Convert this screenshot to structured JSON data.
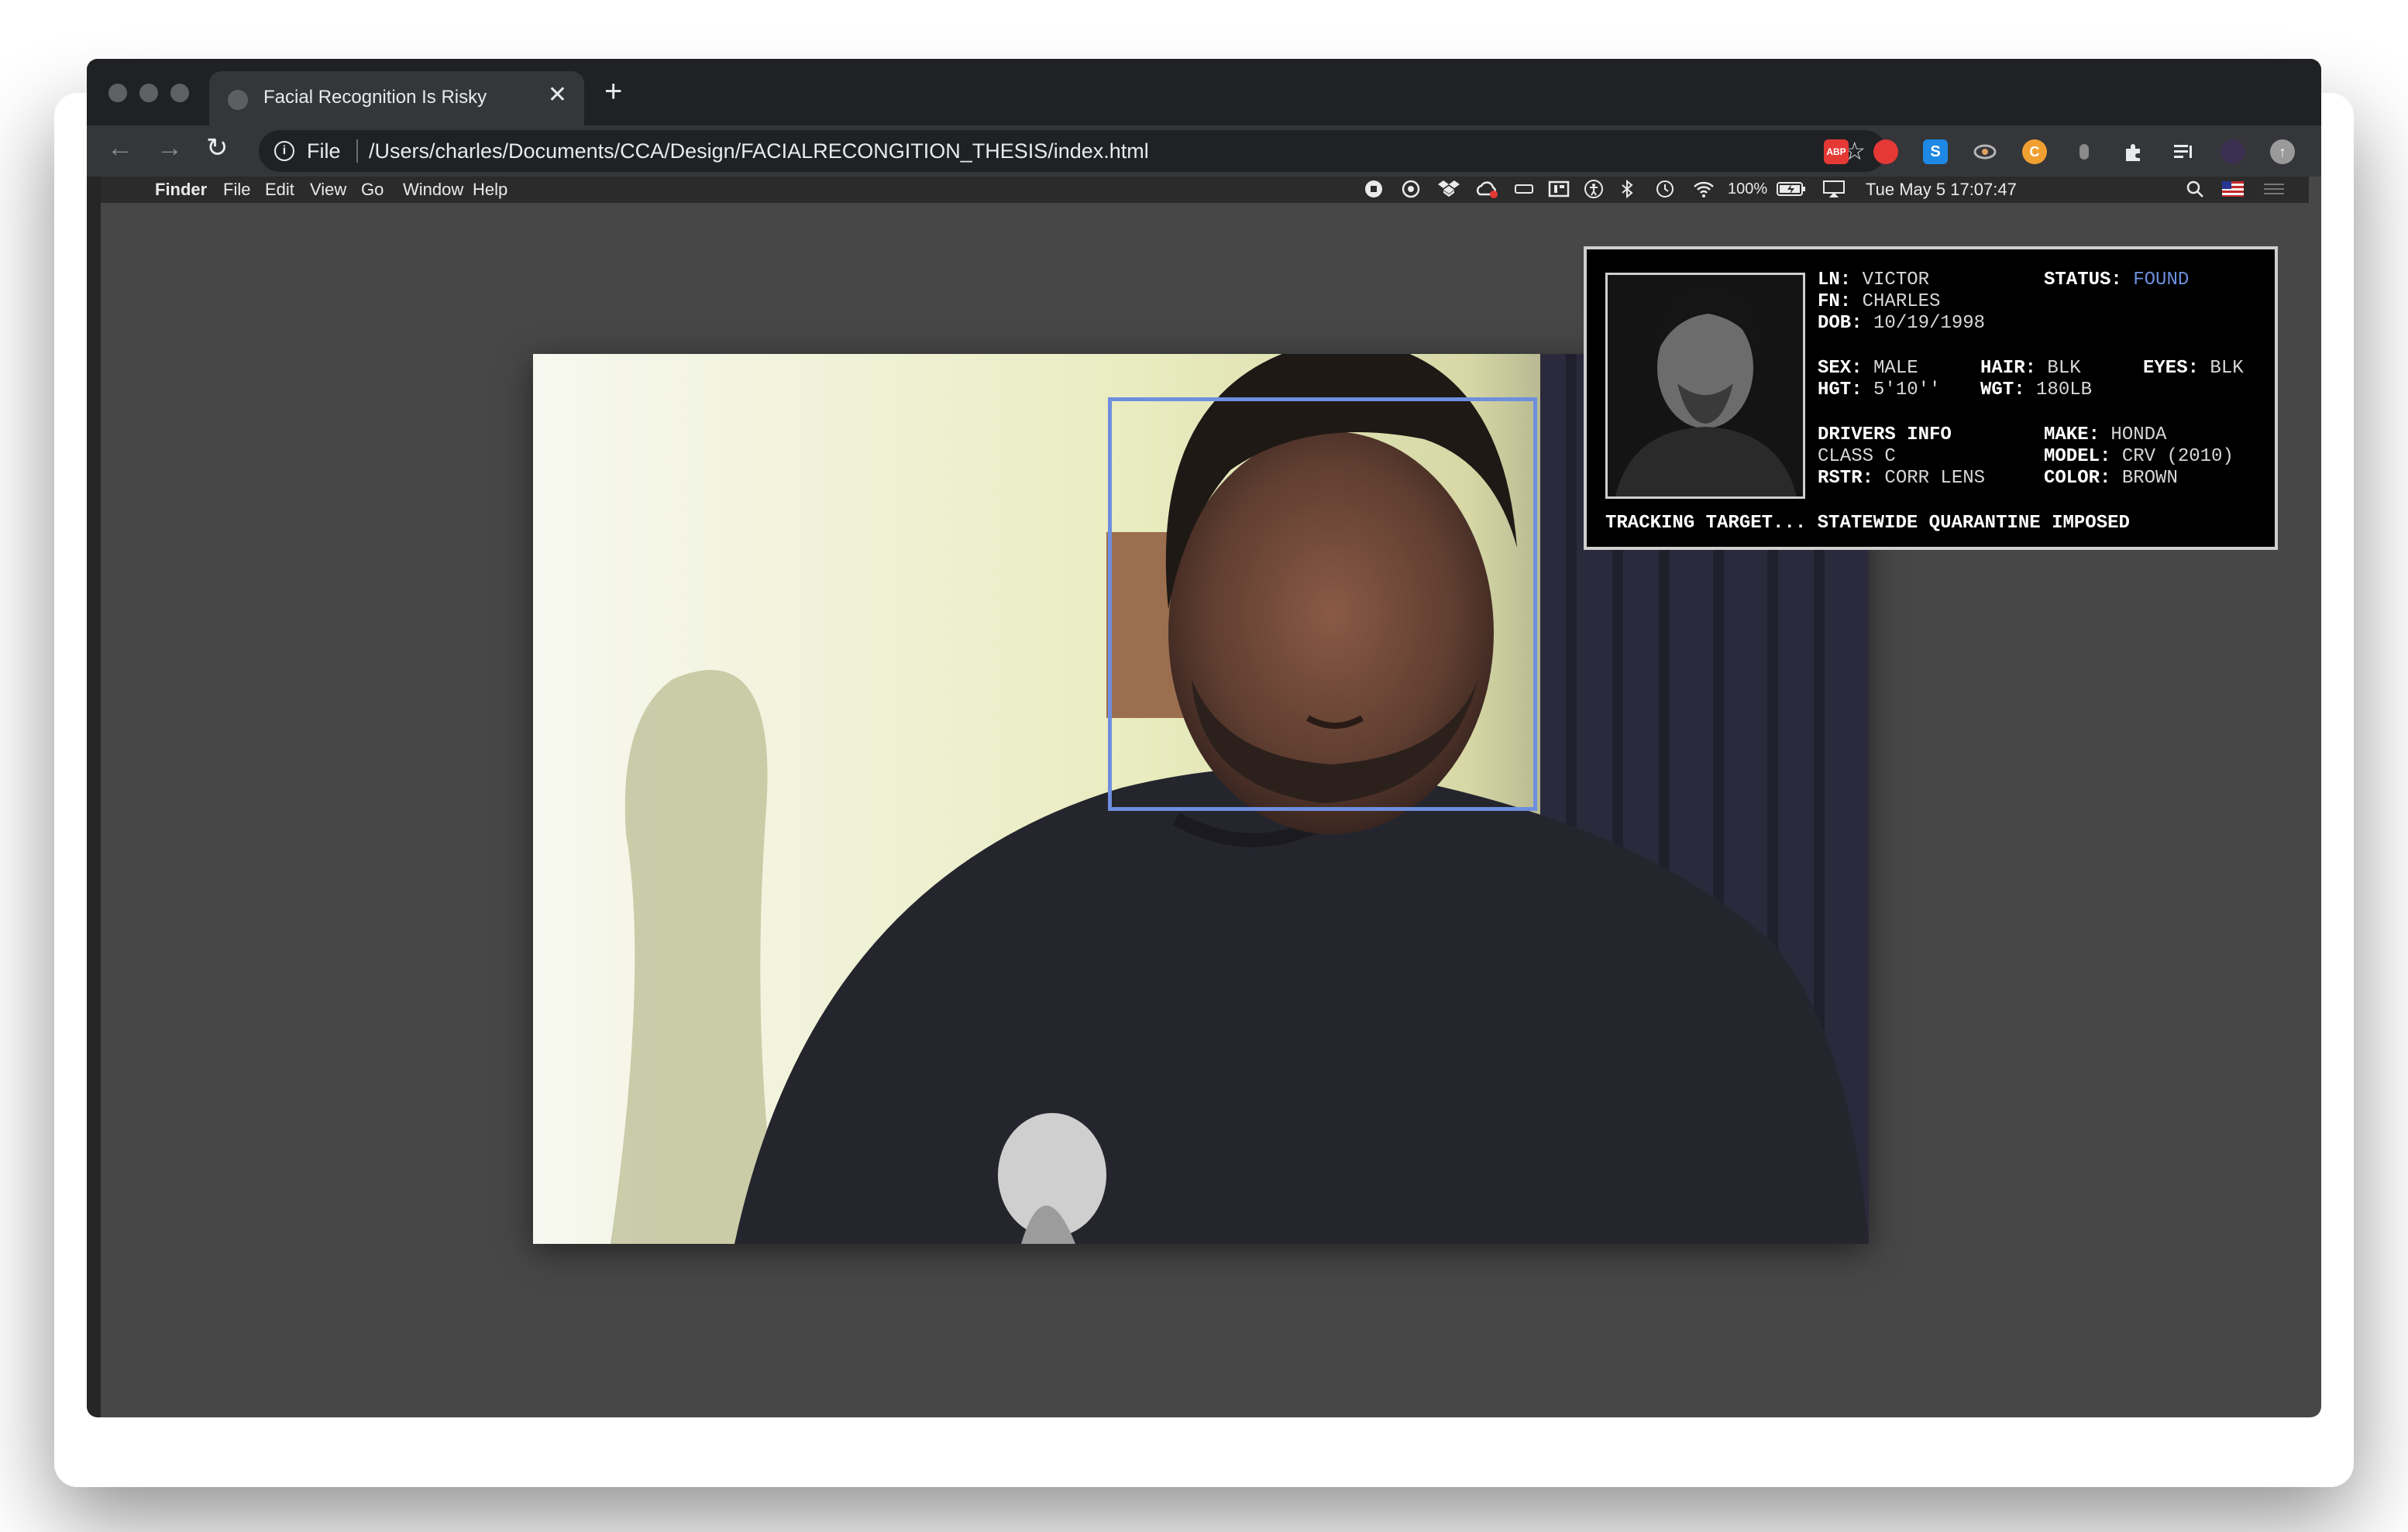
{
  "browser": {
    "tab_title": "Facial Recognition Is Risky",
    "tab_close": "✕",
    "new_tab": "+",
    "nav": {
      "back": "←",
      "forward": "→",
      "reload": "↻",
      "info": "i"
    },
    "address_scheme": "File",
    "address_url": "/Users/charles/Documents/CCA/Design/FACIALRECONGITION_THESIS/index.html",
    "bookmark_star": "☆",
    "extensions": [
      {
        "name": "adblock-plus-icon",
        "label": "ABP",
        "color": "#e53935"
      },
      {
        "name": "red-extension-icon",
        "label": "",
        "color": "#e53935"
      },
      {
        "name": "s-extension-icon",
        "label": "S",
        "color": "#1e88e5"
      },
      {
        "name": "eye-extension-icon",
        "label": "",
        "color": "#9e9e9e"
      },
      {
        "name": "c-extension-icon",
        "label": "C",
        "color": "#f0a030"
      },
      {
        "name": "mouse-extension-icon",
        "label": "",
        "color": "#9e9e9e"
      }
    ]
  },
  "menubar": {
    "apple": "",
    "app": "Finder",
    "items": [
      "File",
      "Edit",
      "View",
      "Go",
      "Window",
      "Help"
    ],
    "battery": "100%",
    "datetime": "Tue May 5  17:07:47"
  },
  "card": {
    "ln_label": "LN:",
    "ln": "VICTOR",
    "status_label": "STATUS:",
    "status": "FOUND",
    "fn_label": "FN:",
    "fn": "CHARLES",
    "dob_label": "DOB:",
    "dob": "10/19/1998",
    "sex_label": "SEX:",
    "sex": "MALE",
    "hair_label": "HAIR:",
    "hair": "BLK",
    "eyes_label": "EYES:",
    "eyes": "BLK",
    "hgt_label": "HGT:",
    "hgt": "5'10''",
    "wgt_label": "WGT:",
    "wgt": "180LB",
    "drivers_label": "DRIVERS INFO",
    "make_label": "MAKE:",
    "make": "HONDA",
    "class": "CLASS C",
    "model_label": "MODEL:",
    "model": "CRV (2010)",
    "rstr_label": "RSTR:",
    "rstr": "CORR LENS",
    "color_label": "COLOR:",
    "color": "BROWN",
    "footer": "TRACKING TARGET... STATEWIDE QUARANTINE IMPOSED"
  },
  "colors": {
    "accent": "#6d8fde",
    "window_bg": "#474747",
    "tabbar_bg": "#202124",
    "toolbar_bg": "#35363a"
  }
}
